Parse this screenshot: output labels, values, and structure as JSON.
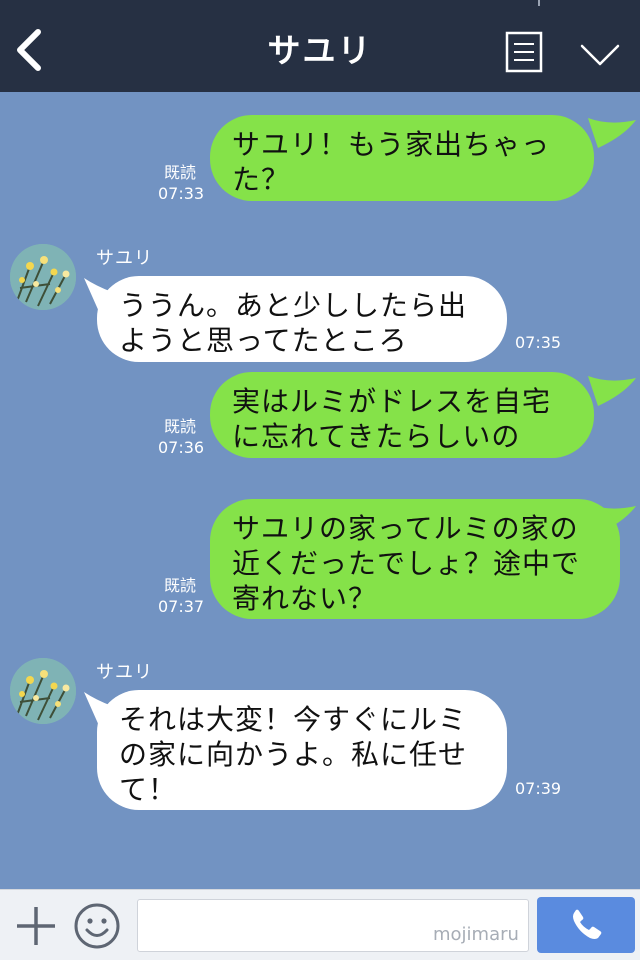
{
  "header": {
    "title": "サユリ"
  },
  "messages": [
    {
      "side": "sent",
      "text": "サユリ！もう家出ちゃった？",
      "read": "既読",
      "time": "07:33"
    },
    {
      "side": "recv",
      "sender": "サユリ",
      "text": "ううん。あと少ししたら出ようと思ってたところ",
      "time": "07:35"
    },
    {
      "side": "sent",
      "text": "実はルミがドレスを自宅に忘れてきたらしいの",
      "read": "既読",
      "time": "07:36"
    },
    {
      "side": "sent",
      "text": "サユリの家ってルミの家の近くだったでしょ？途中で寄れない？",
      "read": "既読",
      "time": "07:37"
    },
    {
      "side": "recv",
      "sender": "サユリ",
      "text": "それは大変！今すぐにルミの家に向かうよ。私に任せて！",
      "time": "07:39"
    }
  ],
  "input": {
    "value": "",
    "watermark": "mojimaru"
  },
  "colors": {
    "header_bg": "#263043",
    "chat_bg": "#7293c2",
    "sent_bubble": "#85e249",
    "recv_bubble": "#ffffff",
    "call_button": "#5a8bdf"
  },
  "icons": {
    "back": "chevron-left-icon",
    "menu": "menu-icon",
    "collapse": "chevron-down-icon",
    "add": "plus-icon",
    "emoji": "smiley-icon",
    "call": "phone-icon"
  }
}
